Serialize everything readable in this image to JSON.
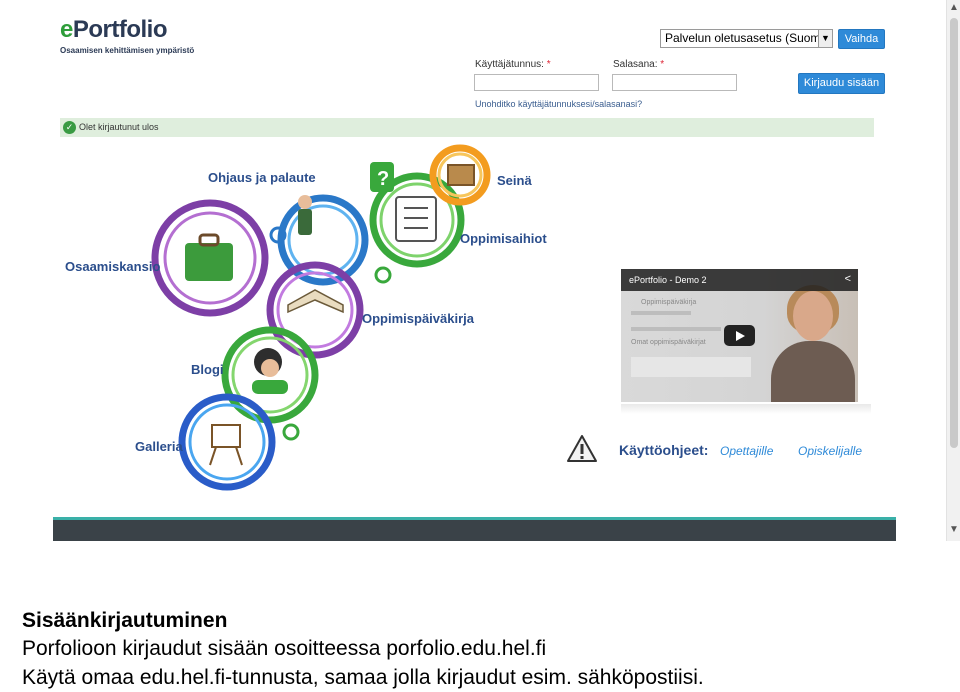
{
  "logo": {
    "brand_e": "e",
    "brand_rest": "Portfolio",
    "tagline": "Osaamisen kehittämisen ympäristö"
  },
  "login": {
    "language_value": "Palvelun oletusasetus (Suomi)",
    "change_button": "Vaihda",
    "username_label": "Käyttäjätunnus:",
    "password_label": "Salasana:",
    "required_mark": "*",
    "submit_button": "Kirjaudu sisään",
    "forgot_link": "Unohditko käyttäjätunnuksesi/salasanasi?"
  },
  "notice": {
    "text": "Olet kirjautunut ulos"
  },
  "illustration": {
    "labels": {
      "ohjaus": "Ohjaus ja palaute",
      "seina": "Seinä",
      "oppimisaihiot": "Oppimisaihiot",
      "osaamiskansio": "Osaamiskansio",
      "oppimispaivakirja": "Oppimispäiväkirja",
      "blogi": "Blogi",
      "galleria": "Galleria"
    }
  },
  "video": {
    "title": "ePortfolio - Demo 2",
    "subtitle": "Oppimispäiväkirja",
    "heading": "Omat oppimispäiväkirjat"
  },
  "instructions": {
    "label": "Käyttöohjeet:",
    "teachers_link": "Opettajille",
    "students_link": "Opiskelijalle"
  },
  "caption": {
    "title": "Sisäänkirjautuminen",
    "line1": "Porfolioon kirjaudut sisään osoitteessa porfolio.edu.hel.fi",
    "line2": "Käytä omaa edu.hel.fi-tunnusta, samaa jolla kirjaudut esim. sähköpostiisi."
  },
  "colors": {
    "accent_blue": "#2e8ad8",
    "notice_green": "#dfeedd",
    "label_navy": "#2b4e8c",
    "footer_teal": "#3ab0a8"
  },
  "icons": [
    "chevron-down-icon",
    "check-icon",
    "share-icon",
    "play-icon",
    "warning-icon"
  ]
}
